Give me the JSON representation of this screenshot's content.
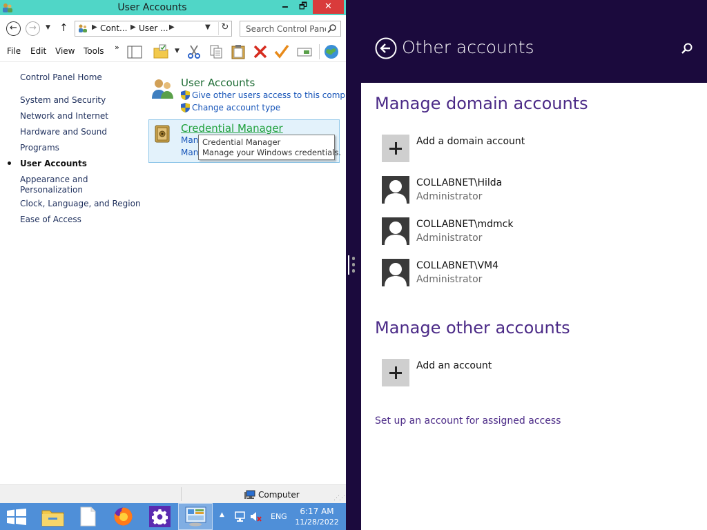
{
  "window": {
    "title": "User Accounts",
    "minimize": "🗕",
    "maximize": "🗗",
    "close": "✕"
  },
  "address": {
    "crumbs": [
      "Cont...",
      "User ..."
    ],
    "search_placeholder": "Search Control Panel"
  },
  "menu": {
    "file": "File",
    "edit": "Edit",
    "view": "View",
    "tools": "Tools",
    "more": "»"
  },
  "sidebar": {
    "home": "Control Panel Home",
    "items": [
      "System and Security",
      "Network and Internet",
      "Hardware and Sound",
      "Programs",
      "User Accounts",
      "Appearance and Personalization",
      "Clock, Language, and Region",
      "Ease of Access"
    ],
    "items_split": {
      "appearance_line1": "Appearance and",
      "appearance_line2": "Personalization"
    }
  },
  "content": {
    "user_accounts": {
      "title": "User Accounts",
      "link_other_users": "Give other users access to this compute",
      "link_change_type": "Change account type"
    },
    "credential_manager": {
      "title": "Credential Manager",
      "link1": "Man",
      "link2": "Man"
    },
    "tooltip": {
      "title": "Credential Manager",
      "text": "Manage your Windows credentials."
    }
  },
  "statusbar": {
    "location": "Computer"
  },
  "taskbar": {
    "language": "ENG",
    "time": "6:17 AM",
    "date": "11/28/2022"
  },
  "settings": {
    "header_title": "Other accounts",
    "domain_section": "Manage domain accounts",
    "add_domain": "Add a domain account",
    "domain_accounts": [
      {
        "name": "COLLABNET\\Hilda",
        "role": "Administrator"
      },
      {
        "name": "COLLABNET\\mdmck",
        "role": "Administrator"
      },
      {
        "name": "COLLABNET\\VM4",
        "role": "Administrator"
      }
    ],
    "other_section": "Manage other accounts",
    "add_account": "Add an account",
    "assigned_access_link": "Set up an account for assigned access"
  },
  "colors": {
    "titlebar": "#50d6c7",
    "close": "#d93b3b",
    "settings_header": "#1b0a3d",
    "settings_accent": "#4b2a87",
    "taskbar": "#4f8fd8",
    "cp_link": "#1654b8",
    "cp_title_green": "#1c6b33"
  }
}
